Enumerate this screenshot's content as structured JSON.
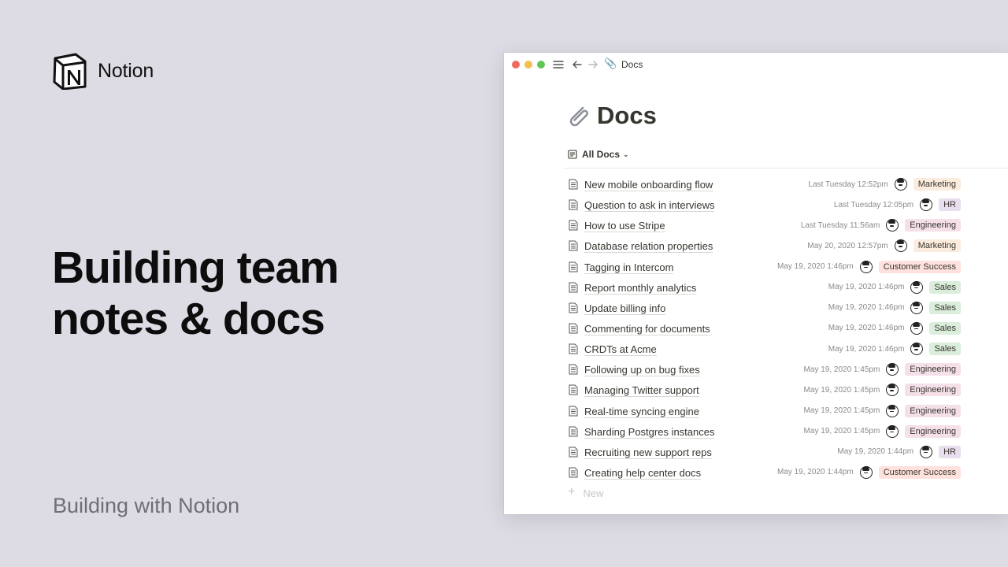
{
  "brand": {
    "name": "Notion",
    "logo_icon": "notion-logo-icon"
  },
  "headline": {
    "line1": "Building team",
    "line2": "notes & docs"
  },
  "subtitle": "Building with Notion",
  "window": {
    "titlebar": {
      "traffic_lights": [
        "#ee6a5e",
        "#f5bf4f",
        "#61c554"
      ],
      "breadcrumb": "Docs",
      "breadcrumb_icon": "paperclip-icon"
    },
    "page": {
      "icon": "paperclip-icon",
      "title": "Docs",
      "view_label": "All Docs",
      "new_label": "New"
    },
    "tag_colors": {
      "Marketing": "#fbecdd",
      "HR": "#e8deee",
      "Engineering": "#f5e0e9",
      "Customer Success": "#ffe2dd",
      "Sales": "#dbeddb"
    },
    "rows": [
      {
        "title": "New mobile onboarding flow",
        "date": "Last Tuesday 12:52pm",
        "tag": "Marketing"
      },
      {
        "title": "Question to ask in interviews",
        "date": "Last Tuesday 12:05pm",
        "tag": "HR"
      },
      {
        "title": "How to use Stripe",
        "date": "Last Tuesday 11:56am",
        "tag": "Engineering"
      },
      {
        "title": "Database relation properties",
        "date": "May 20, 2020 12:57pm",
        "tag": "Marketing"
      },
      {
        "title": "Tagging in Intercom",
        "date": "May 19, 2020 1:46pm",
        "tag": "Customer Success"
      },
      {
        "title": "Report monthly analytics",
        "date": "May 19, 2020 1:46pm",
        "tag": "Sales"
      },
      {
        "title": "Update billing info",
        "date": "May 19, 2020 1:46pm",
        "tag": "Sales"
      },
      {
        "title": "Commenting for documents",
        "date": "May 19, 2020 1:46pm",
        "tag": "Sales"
      },
      {
        "title": "CRDTs at Acme",
        "date": "May 19, 2020 1:46pm",
        "tag": "Sales"
      },
      {
        "title": "Following up on bug fixes",
        "date": "May 19, 2020 1:45pm",
        "tag": "Engineering"
      },
      {
        "title": "Managing Twitter support",
        "date": "May 19, 2020 1:45pm",
        "tag": "Engineering"
      },
      {
        "title": "Real-time syncing engine",
        "date": "May 19, 2020 1:45pm",
        "tag": "Engineering"
      },
      {
        "title": "Sharding Postgres instances",
        "date": "May 19, 2020 1:45pm",
        "tag": "Engineering"
      },
      {
        "title": "Recruiting new support reps",
        "date": "May 19, 2020 1:44pm",
        "tag": "HR"
      },
      {
        "title": "Creating help center docs",
        "date": "May 19, 2020 1:44pm",
        "tag": "Customer Success"
      }
    ]
  }
}
